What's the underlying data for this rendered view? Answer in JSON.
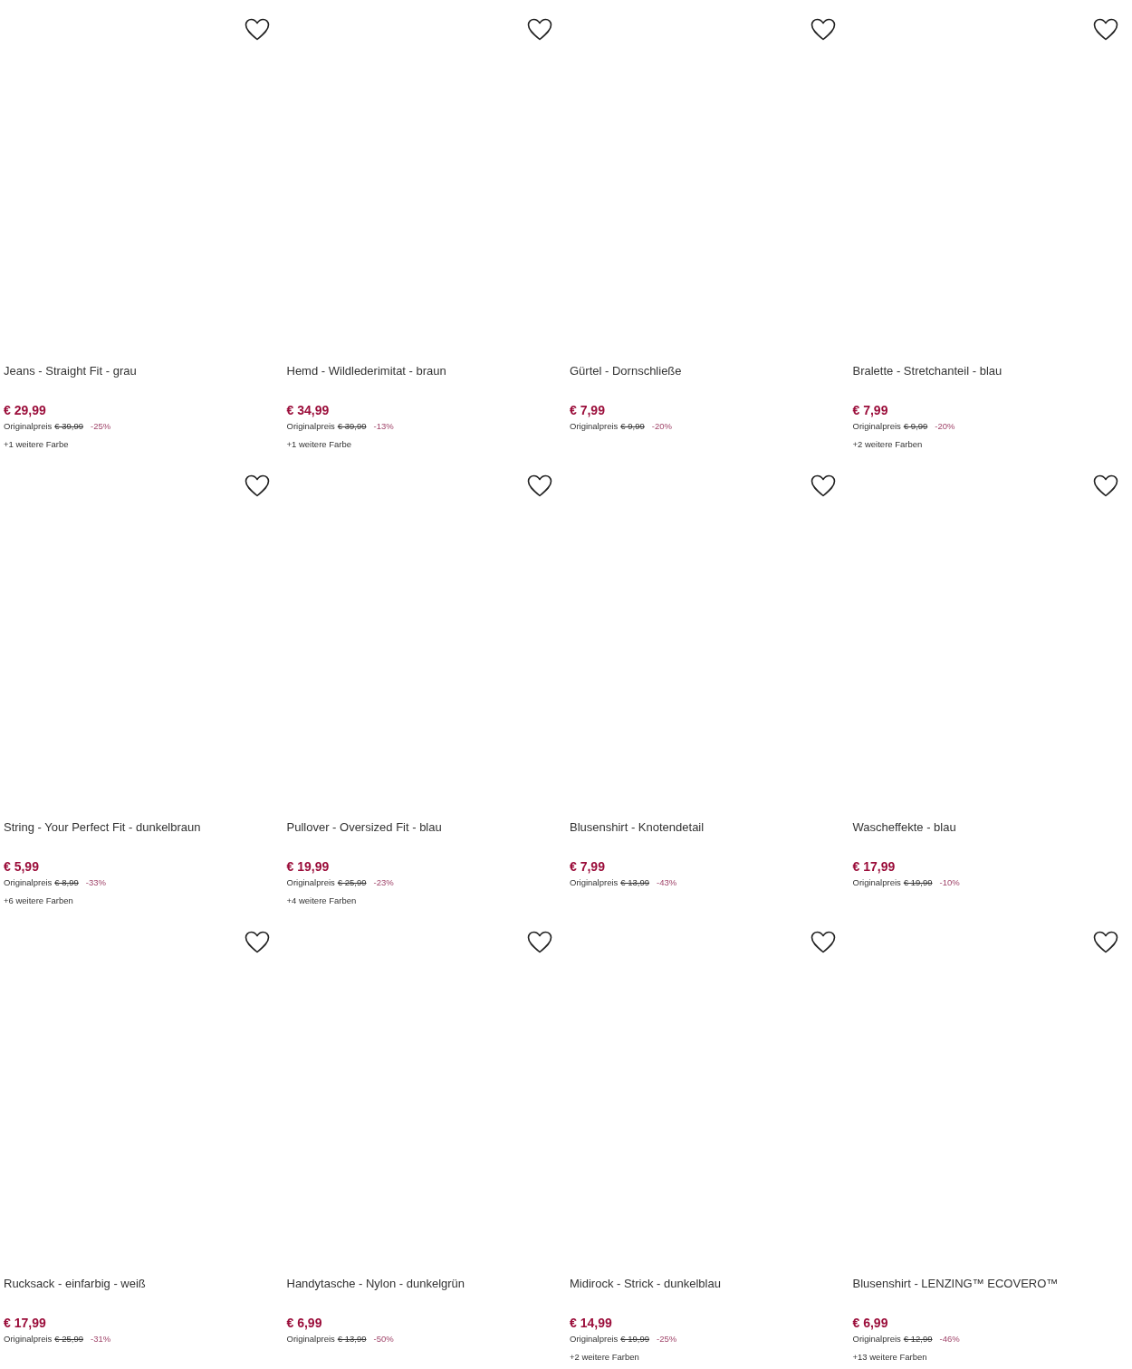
{
  "products": [
    {
      "title": "Jeans - Straight Fit - grau",
      "price": "€ 29,99",
      "original_label": "Originalpreis",
      "original_price": "€ 39,99",
      "discount": "-25%",
      "colors": "+1 weitere Farbe"
    },
    {
      "title": "Hemd - Wildlederimitat - braun",
      "price": "€ 34,99",
      "original_label": "Originalpreis",
      "original_price": "€ 39,99",
      "discount": "-13%",
      "colors": "+1 weitere Farbe"
    },
    {
      "title": "Gürtel - Dornschließe",
      "price": "€ 7,99",
      "original_label": "Originalpreis",
      "original_price": "€ 9,99",
      "discount": "-20%"
    },
    {
      "title": "Bralette - Stretchanteil - blau",
      "price": "€ 7,99",
      "original_label": "Originalpreis",
      "original_price": "€ 9,99",
      "discount": "-20%",
      "colors": "+2 weitere Farben"
    },
    {
      "title": "String - Your Perfect Fit - dunkelbraun",
      "price": "€ 5,99",
      "original_label": "Originalpreis",
      "original_price": "€ 8,99",
      "discount": "-33%",
      "colors": "+6 weitere Farben"
    },
    {
      "title": "Pullover - Oversized Fit - blau",
      "price": "€ 19,99",
      "original_label": "Originalpreis",
      "original_price": "€ 25,99",
      "discount": "-23%",
      "colors": "+4 weitere Farben"
    },
    {
      "title": "Blusenshirt - Knotendetail",
      "price": "€ 7,99",
      "original_label": "Originalpreis",
      "original_price": "€ 13,99",
      "discount": "-43%"
    },
    {
      "title": "Wascheffekte - blau",
      "price": "€ 17,99",
      "original_label": "Originalpreis",
      "original_price": "€ 19,99",
      "discount": "-10%"
    },
    {
      "title": "Rucksack - einfarbig - weiß",
      "price": "€ 17,99",
      "original_label": "Originalpreis",
      "original_price": "€ 25,99",
      "discount": "-31%"
    },
    {
      "title": "Handytasche - Nylon - dunkelgrün",
      "price": "€ 6,99",
      "original_label": "Originalpreis",
      "original_price": "€ 13,99",
      "discount": "-50%"
    },
    {
      "title": "Midirock - Strick - dunkelblau",
      "price": "€ 14,99",
      "original_label": "Originalpreis",
      "original_price": "€ 19,99",
      "discount": "-25%",
      "colors": "+2 weitere Farben"
    },
    {
      "title": "Blusenshirt - LENZING™ ECOVERO™",
      "price": "€ 6,99",
      "original_label": "Originalpreis",
      "original_price": "€ 12,99",
      "discount": "-46%",
      "colors": "+13 weitere Farben"
    }
  ]
}
